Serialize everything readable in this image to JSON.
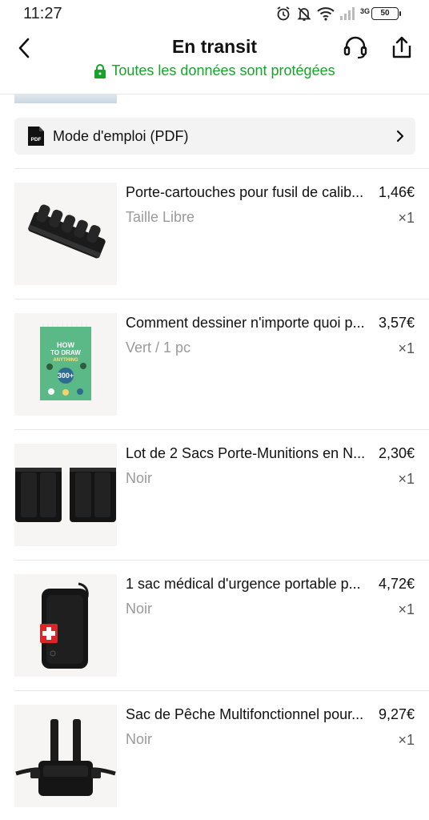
{
  "status_bar": {
    "time": "11:27",
    "network": "3G",
    "battery": "50"
  },
  "header": {
    "title": "En transit",
    "security_text": "Toutes les données sont protégées",
    "security_color": "#17a329"
  },
  "manual": {
    "label": "Mode d'emploi (PDF)",
    "icon_text": "PDF"
  },
  "items": [
    {
      "title": "Porte-cartouches pour fusil de calib...",
      "price": "1,46€",
      "variant": "Taille Libre",
      "qty": "×1",
      "image": "cartridge-holder"
    },
    {
      "title": "Comment dessiner n'importe quoi p...",
      "price": "3,57€",
      "variant": "Vert / 1 pc",
      "qty": "×1",
      "image": "how-to-draw-book",
      "book": {
        "line1": "HOW",
        "line2": "TO DRAW",
        "line3": "ANYTHING",
        "number": "300+"
      }
    },
    {
      "title": "Lot de 2 Sacs Porte-Munitions en N...",
      "price": "2,30€",
      "variant": "Noir",
      "qty": "×1",
      "image": "ammo-pouches"
    },
    {
      "title": "1 sac médical d'urgence portable p...",
      "price": "4,72€",
      "variant": "Noir",
      "qty": "×1",
      "image": "medical-bag"
    },
    {
      "title": "Sac de Pêche Multifonctionnel pour...",
      "price": "9,27€",
      "variant": "Noir",
      "qty": "×1",
      "image": "chest-rig-bag"
    }
  ]
}
